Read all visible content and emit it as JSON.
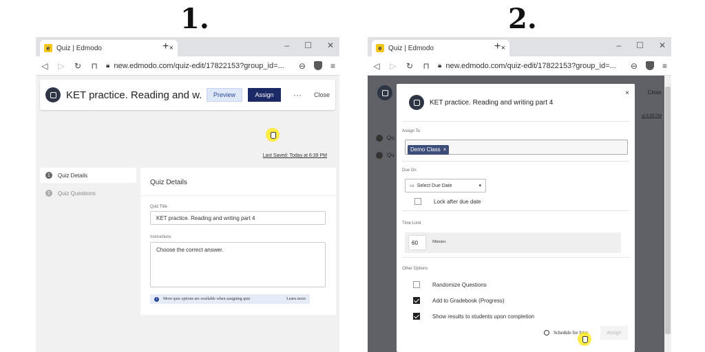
{
  "steps": {
    "first": "1.",
    "second": "2."
  },
  "browser": {
    "tab_title": "Quiz | Edmodo",
    "tab_close": "×",
    "new_tab": "+",
    "window_min": "–",
    "window_max": "☐",
    "window_close": "✕",
    "url": "new.edmodo.com/quiz-edit/17822153?group_id=...",
    "favicon": "e",
    "icons": [
      "back-icon",
      "forward-icon",
      "reload-icon",
      "bookmark-icon",
      "lock-icon",
      "zoom-icon",
      "brave-shield-icon",
      "menu-icon"
    ]
  },
  "header": {
    "title": "KET practice. Reading and w...",
    "preview_label": "Preview",
    "assign_label": "Assign",
    "more_label": "···",
    "close_label": "Close"
  },
  "last_saved": "Last Saved: Today at 6:39 PM",
  "sidebar": {
    "items": [
      {
        "num": "1",
        "label": "Quiz Details"
      },
      {
        "num": "2",
        "label": "Quiz Questions"
      }
    ]
  },
  "details": {
    "heading": "Quiz Details",
    "quiz_title_label": "Quiz Title",
    "quiz_title_value": "KET practice. Reading and writing part 4",
    "instructions_label": "Instructions",
    "instructions_value": "Choose the correct answer.",
    "info_icon": "i",
    "info_text": "More quiz options are available when assigning quiz",
    "learn_more": "Learn more"
  },
  "background": {
    "close_label": "Close",
    "saved_fragment": "at 6:39 PM",
    "sidebar_fragment": "Qu"
  },
  "modal": {
    "close": "×",
    "title": "KET practice. Reading and writing part 4",
    "assign_to_label": "Assign To",
    "chip_label": "Demo Class",
    "chip_remove": "×",
    "due_on_label": "Due On",
    "due_placeholder": "Select Due Date",
    "due_caret": "▾",
    "lock_label": "Lock after due date",
    "time_limit_label": "Time Limit",
    "time_value": "60",
    "minutes_label": "Minutes",
    "other_options_label": "Other Options",
    "options": [
      {
        "label": "Randomize Questions",
        "checked": false
      },
      {
        "label": "Add to Gradebook (Progress)",
        "checked": true
      },
      {
        "label": "Show results to students upon completion",
        "checked": true
      }
    ],
    "schedule_label": "Schedule for later",
    "assign_label": "Assign"
  },
  "colors": {
    "assign_button": "#1b2a66",
    "preview_button": "#dfe8f7",
    "overlay": "#5f6166",
    "chip": "#3e4e7a",
    "cursor_highlight": "#ffeb28"
  }
}
